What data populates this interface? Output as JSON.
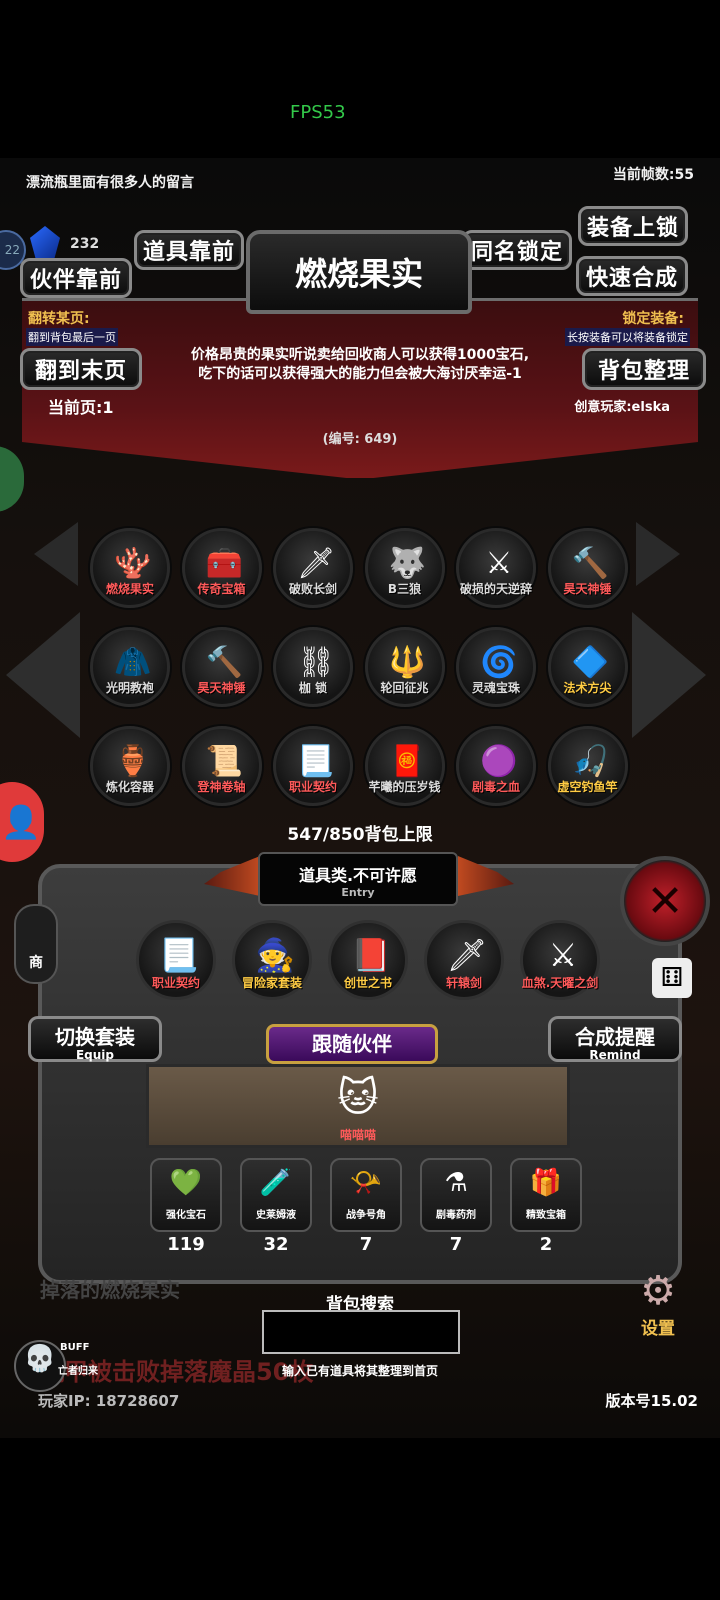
{
  "status": {
    "fps_label": "FPS53"
  },
  "top": {
    "message": "漂流瓶里面有很多人的留言",
    "fps_count": "当前帧数:55",
    "gem_count": "232",
    "side_num": "22"
  },
  "buttons": {
    "item_front": "道具靠前",
    "partner_front": "伙伴靠前",
    "same_name_lock": "同名锁定",
    "equip_lock": "装备上锁",
    "quick_craft": "快速合成",
    "goto_last": "翻到末页",
    "bag_sort": "背包整理",
    "switch_set": "切换套装",
    "switch_set_sub": "Equip",
    "craft_remind": "合成提醒",
    "craft_remind_sub": "Remind",
    "follow_partner": "跟随伙伴",
    "settings": "设置"
  },
  "detail": {
    "title": "燃烧果实",
    "flip_label": "翻转某页:",
    "flip_hint": "翻到背包最后一页",
    "lock_label": "锁定装备:",
    "lock_hint": "长按装备可以将装备锁定",
    "description_line1": "价格昂贵的果实听说卖给回收商人可以获得1000宝石,",
    "description_line2": "吃下的话可以获得强大的能力但会被大海讨厌幸运-1",
    "current_page": "当前页:1",
    "creator": "创意玩家:elska",
    "serial": "(编号: 649)"
  },
  "grid": [
    {
      "name": "燃烧果实",
      "icon": "🪸",
      "color": "#ff5a5a"
    },
    {
      "name": "传奇宝箱",
      "icon": "🧰",
      "color": "#ff5a5a"
    },
    {
      "name": "破败长剑",
      "icon": "🗡",
      "color": "#dddddd"
    },
    {
      "name": "B三狼",
      "icon": "🐺",
      "color": "#dddddd"
    },
    {
      "name": "破损的天逆辞",
      "icon": "⚔",
      "color": "#dddddd"
    },
    {
      "name": "昊天神锤",
      "icon": "🔨",
      "color": "#ff5a5a"
    },
    {
      "name": "光明教袍",
      "icon": "🧥",
      "color": "#dddddd"
    },
    {
      "name": "昊天神锤",
      "icon": "🔨",
      "color": "#ff5a5a"
    },
    {
      "name": "枷 锁",
      "icon": "⛓",
      "color": "#dddddd"
    },
    {
      "name": "轮回征兆",
      "icon": "🔱",
      "color": "#dddddd"
    },
    {
      "name": "灵魂宝珠",
      "icon": "🌀",
      "color": "#dddddd"
    },
    {
      "name": "法术方尖",
      "icon": "🔷",
      "color": "#ffcc44"
    },
    {
      "name": "炼化容器",
      "icon": "🏺",
      "color": "#dddddd"
    },
    {
      "name": "登神卷轴",
      "icon": "📜",
      "color": "#ff5a5a"
    },
    {
      "name": "职业契约",
      "icon": "📃",
      "color": "#ff5a5a"
    },
    {
      "name": "芊曦的压岁钱",
      "icon": "🧧",
      "color": "#dddddd"
    },
    {
      "name": "剧毒之血",
      "icon": "🟣",
      "color": "#ff5a5a"
    },
    {
      "name": "虚空钓鱼竿",
      "icon": "🎣",
      "color": "#ffcc44"
    }
  ],
  "bag": {
    "capacity": "547/850背包上限"
  },
  "entry": {
    "title": "道具类.不可许愿",
    "sub": "Entry"
  },
  "equipped": [
    {
      "name": "职业契约",
      "icon": "📃",
      "color": "#ff5a5a"
    },
    {
      "name": "冒险家套装",
      "icon": "🧙",
      "color": "#ffcc44"
    },
    {
      "name": "创世之书",
      "icon": "📕",
      "color": "#ffcc44"
    },
    {
      "name": "轩辕剑",
      "icon": "🗡",
      "color": "#ff5a5a"
    },
    {
      "name": "血煞.天曜之剑",
      "icon": "⚔",
      "color": "#ff5a5a"
    }
  ],
  "partner": {
    "name": "喵喵喵",
    "icon": "🐱"
  },
  "materials": [
    {
      "name": "强化宝石",
      "icon": "💚",
      "count": "119"
    },
    {
      "name": "史莱姆液",
      "icon": "🧪",
      "count": "32"
    },
    {
      "name": "战争号角",
      "icon": "📯",
      "count": "7"
    },
    {
      "name": "剧毒药剂",
      "icon": "⚗",
      "count": "7"
    },
    {
      "name": "精致宝箱",
      "icon": "🎁",
      "count": "2"
    }
  ],
  "search": {
    "label": "背包搜索",
    "value": "",
    "hint": "输入已有道具将其整理到首页"
  },
  "footer": {
    "ticker": "机甲被击败掉落魔晶50枚",
    "ticker_bg": "掉落的燃烧果实",
    "player_ip": "玩家IP: 18728607",
    "version": "版本号15.02",
    "buff_top": "BUFF",
    "buff_bottom": "亡者归来",
    "shop_label": "商"
  }
}
